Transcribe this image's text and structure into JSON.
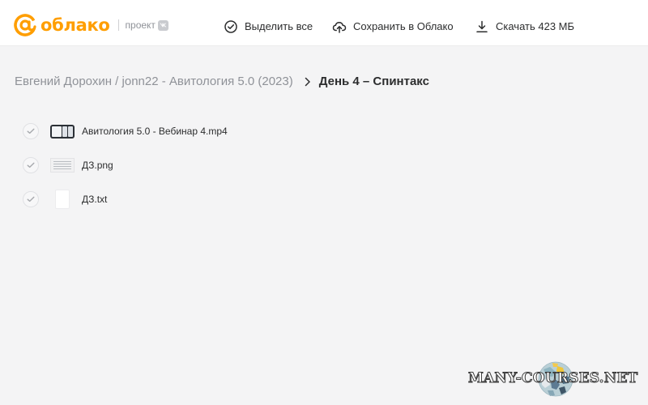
{
  "header": {
    "logo_text": "облако",
    "project_label": "проект",
    "accent_color": "#ff9e00",
    "actions": {
      "select_all": "Выделить все",
      "save_to_cloud": "Сохранить в Облако",
      "download": "Скачать 423 МБ"
    }
  },
  "breadcrumbs": {
    "path": "Евгений Дорохин / jonn22 - Авитология 5.0 (2023)",
    "current": "День 4 – Спинтакс"
  },
  "files": [
    {
      "name": "Авитология 5.0 - Вебинар 4.mp4",
      "thumb": "video-thumbnail"
    },
    {
      "name": "ДЗ.png",
      "thumb": "image-thumbnail"
    },
    {
      "name": "ДЗ.txt",
      "thumb": "document-icon"
    }
  ],
  "icons": {
    "select_all": "check-circle-icon",
    "save_to_cloud": "cloud-upload-icon",
    "download": "download-icon",
    "breadcrumb_separator": "chevron-right-icon",
    "file_checkbox": "check-icon"
  },
  "watermark": {
    "text": "MANY-COURSES.NET"
  }
}
